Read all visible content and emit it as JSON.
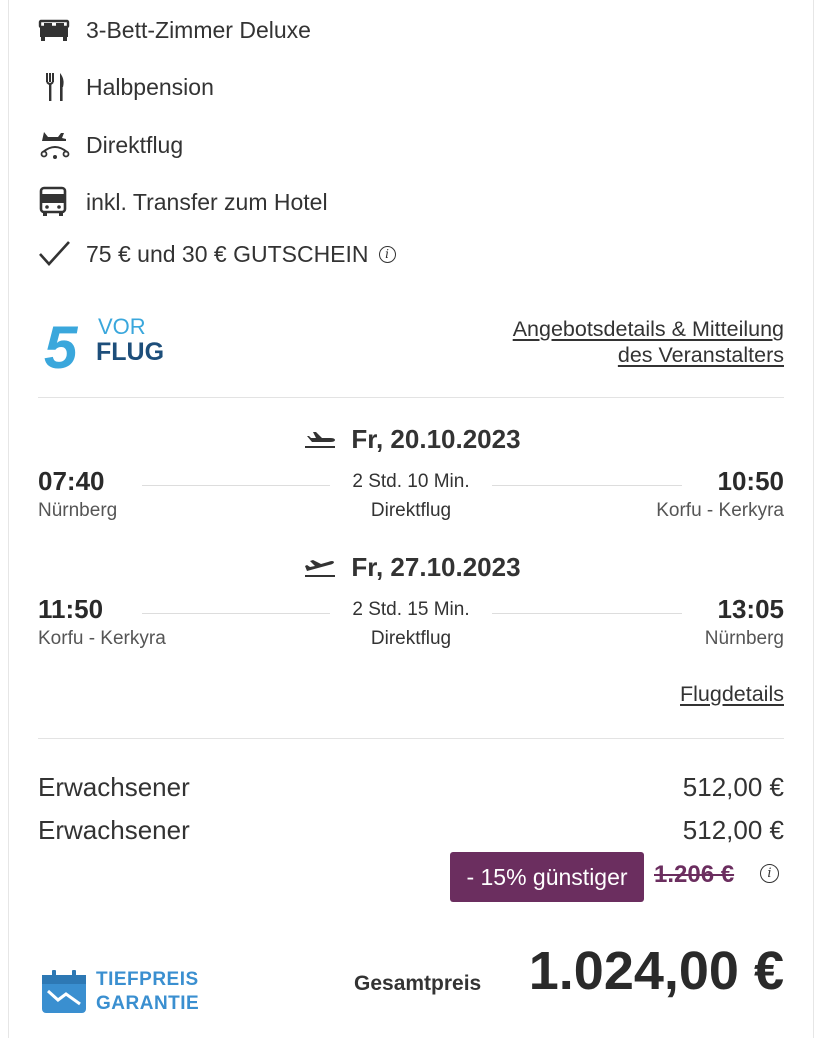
{
  "features": [
    {
      "icon": "bed-icon",
      "text": "3-Bett-Zimmer Deluxe"
    },
    {
      "icon": "cutlery-icon",
      "text": "Halbpension"
    },
    {
      "icon": "plane-car-icon",
      "text": "Direktflug"
    },
    {
      "icon": "bus-icon",
      "text": "inkl. Transfer zum Hotel"
    },
    {
      "icon": "checkmark-icon",
      "text": "75 € und 30 € GUTSCHEIN"
    }
  ],
  "logo": {
    "number": "5",
    "line1": "VOR",
    "line2": "FLUG"
  },
  "offer_link": {
    "line1": "Angebotsdetails & Mitteilung",
    "line2": "des Veranstalters"
  },
  "outbound": {
    "date": "Fr, 20.10.2023",
    "dep_time": "07:40",
    "dep_place": "Nürnberg",
    "duration": "2 Std. 10 Min.",
    "kind": "Direktflug",
    "arr_time": "10:50",
    "arr_place": "Korfu - Kerkyra"
  },
  "return": {
    "date": "Fr, 27.10.2023",
    "dep_time": "11:50",
    "dep_place": "Korfu - Kerkyra",
    "duration": "2 Std. 15 Min.",
    "kind": "Direktflug",
    "arr_time": "13:05",
    "arr_place": "Nürnberg"
  },
  "flugdetails": "Flugdetails",
  "prices": [
    {
      "label": "Erwachsener",
      "value": "512,00 €"
    },
    {
      "label": "Erwachsener",
      "value": "512,00 €"
    }
  ],
  "discount": "- 15% günstiger",
  "old_price": "1.206 €",
  "guarantee": {
    "line1": "TIEFPREIS",
    "line2": "GARANTIE"
  },
  "total_label": "Gesamtpreis",
  "total": "1.024,00 €",
  "colors": {
    "accent_purple": "#6b2e5f",
    "guarantee_blue": "#3a8fd0",
    "logo_blue": "#3aa7dc"
  }
}
